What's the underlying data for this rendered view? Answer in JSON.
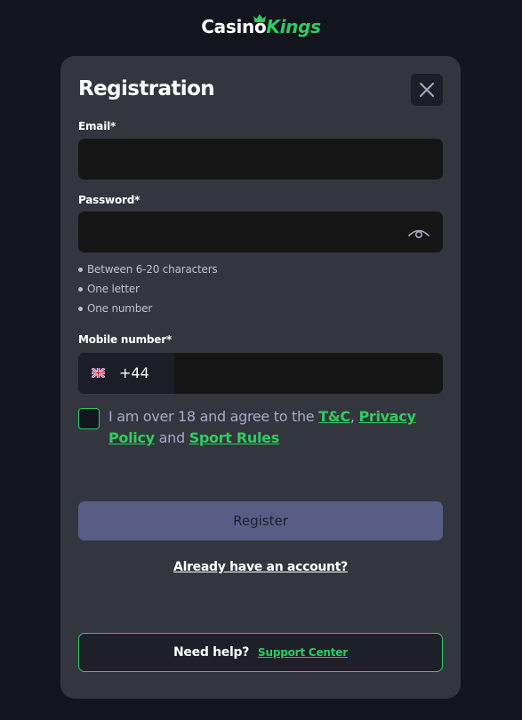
{
  "logo": {
    "part1": "Casino",
    "part2": "Kings"
  },
  "form": {
    "title": "Registration",
    "email_label": "Email*",
    "email_value": "",
    "password_label": "Password*",
    "password_value": "",
    "password_rules": [
      "Between 6-20 characters",
      "One letter",
      "One number"
    ],
    "mobile_label": "Mobile number*",
    "country_code": "+44",
    "phone_value": ""
  },
  "terms": {
    "prefix": "I am over 18 and agree to the ",
    "tc": "T&C",
    "comma": ", ",
    "privacy": "Privacy Policy",
    "and": " and ",
    "sport_rules": "Sport Rules",
    "checked": false
  },
  "actions": {
    "register": "Register",
    "already": "Already have an account?"
  },
  "help": {
    "text": "Need help?",
    "link": "Support Center"
  },
  "colors": {
    "accent": "#2ecc5e",
    "background": "#14141f",
    "card": "#33363e",
    "input": "#151515",
    "register_button": "#575d84"
  }
}
